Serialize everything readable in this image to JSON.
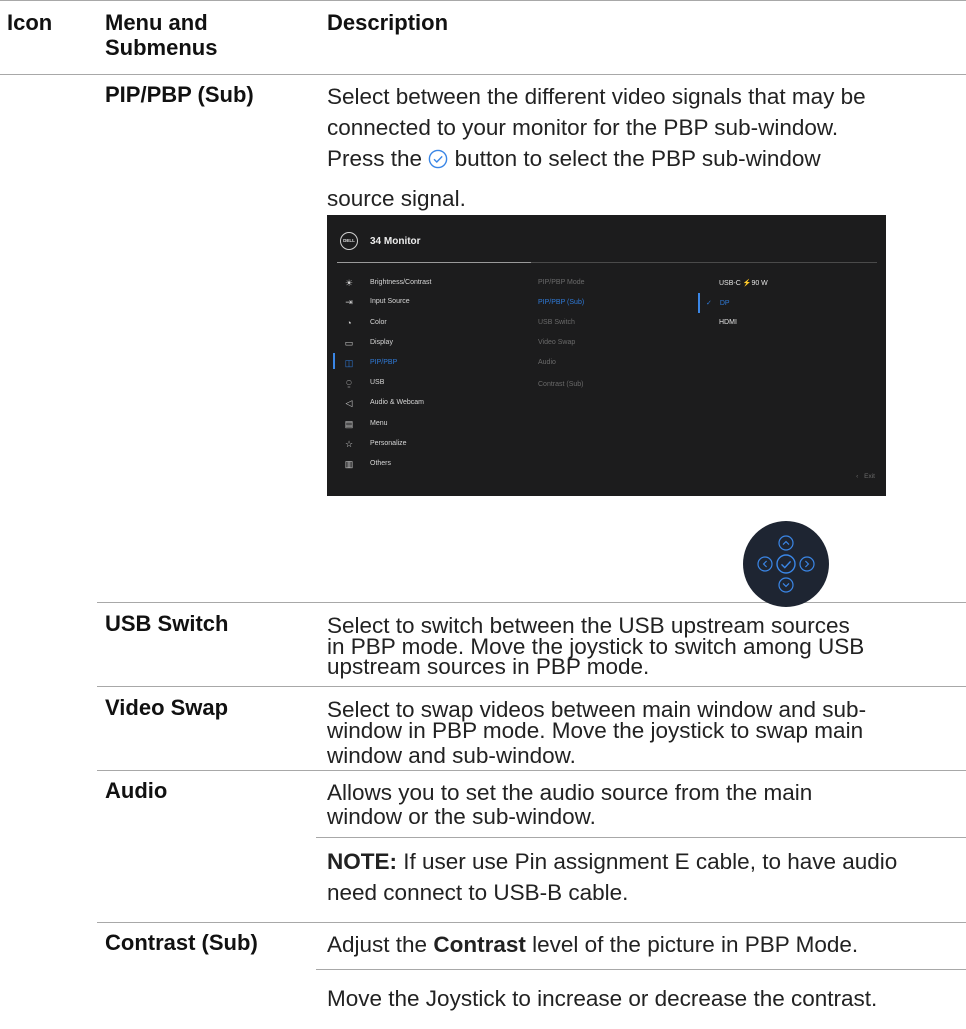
{
  "header": {
    "col_icon": "Icon",
    "col_menu": "Menu and Submenus",
    "col_menu_line1": "Menu and",
    "col_menu_line2": "Submenus",
    "col_desc": "Description"
  },
  "rows": [
    {
      "menu": "PIP/PBP (Sub)",
      "desc_lines": [
        "Select between the different video signals that may be",
        "connected to your monitor for the PBP sub-window.",
        "button to select the PBP sub-window",
        "source signal."
      ],
      "press_the": "Press the",
      "icon": "check-circle-icon"
    },
    {
      "menu": "USB Switch",
      "desc_lines": [
        "Select to switch between the USB upstream sources",
        "in PBP mode. Move the joystick to switch among USB",
        "upstream sources in PBP mode."
      ]
    },
    {
      "menu": "Video Swap",
      "desc_lines": [
        "Select to swap videos between main window and sub-",
        "window in PBP mode. Move the joystick to swap main",
        "window and sub-window."
      ]
    },
    {
      "menu": "Audio",
      "desc_lines": [
        "Allows you to set the audio source from the main",
        "window or the sub-window."
      ],
      "note_label": "NOTE:",
      "note_lines": [
        "If user use Pin assignment E cable, to have audio",
        "need connect to USB-B cable."
      ]
    },
    {
      "menu": "Contrast (Sub)",
      "desc_prefix": "Adjust the",
      "desc_bold": "Contrast",
      "desc_suffix": "level of the picture in PBP Mode.",
      "desc_line2": "Move the Joystick to increase or decrease the contrast."
    }
  ],
  "osd": {
    "logo": "DELL",
    "title": "34 Monitor",
    "menu_items": [
      {
        "label": "Brightness/Contrast",
        "icon": "sun-icon"
      },
      {
        "label": "Input Source",
        "icon": "input-icon"
      },
      {
        "label": "Color",
        "icon": "palette-icon"
      },
      {
        "label": "Display",
        "icon": "display-icon"
      },
      {
        "label": "PIP/PBP",
        "icon": "pip-icon"
      },
      {
        "label": "USB",
        "icon": "usb-icon"
      },
      {
        "label": "Audio & Webcam",
        "icon": "speaker-icon"
      },
      {
        "label": "Menu",
        "icon": "menu-icon"
      },
      {
        "label": "Personalize",
        "icon": "star-icon"
      },
      {
        "label": "Others",
        "icon": "others-icon"
      }
    ],
    "active_menu": "PIP/PBP",
    "submenu": [
      "PIP/PBP Mode",
      "PIP/PBP (Sub)",
      "USB Switch",
      "Video Swap",
      "Audio",
      "Contrast (Sub)"
    ],
    "active_submenu": "PIP/PBP (Sub)",
    "options": [
      "USB-C ⚡90 W",
      "DP",
      "HDMI"
    ],
    "selected_option": "DP",
    "exit_label": "Exit",
    "accent": "#2f7ad8"
  },
  "colors": {
    "rule": "#a8a8a8",
    "osd_bg": "#1c1c1d",
    "joystick_bg": "#1e2532",
    "accent": "#2f7ad8"
  }
}
